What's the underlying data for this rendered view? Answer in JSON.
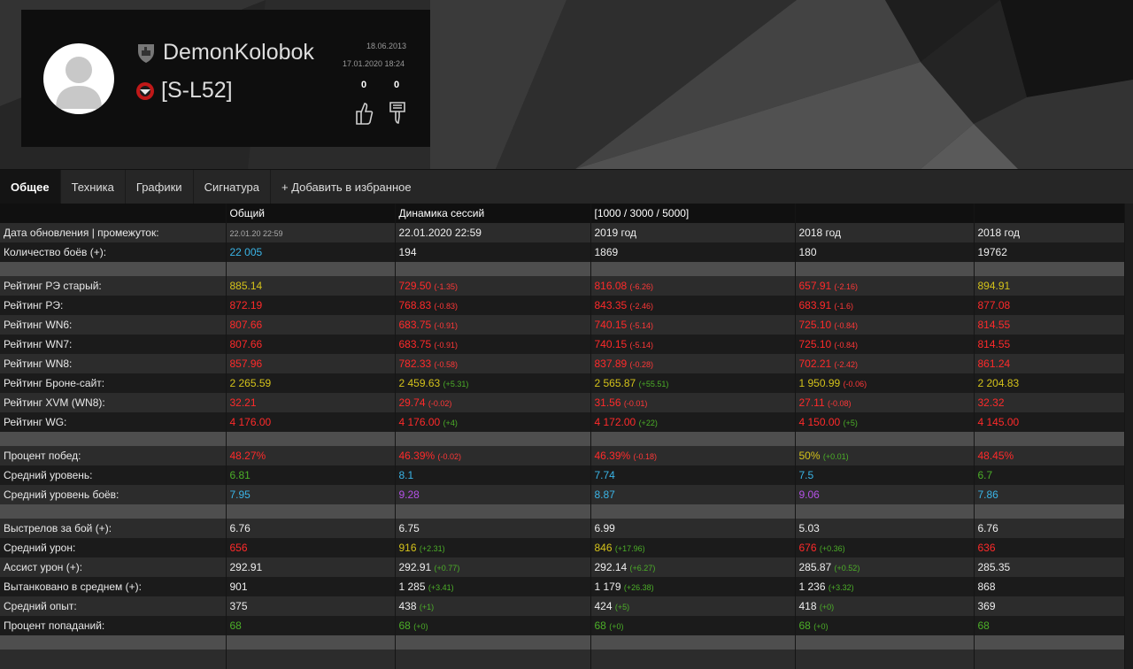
{
  "colors": {
    "red": "#ff2a2a",
    "yellow": "#d4c21a",
    "blue": "#3ab4e6",
    "green": "#4caf28",
    "purple": "#b451e6",
    "white": "#eeeeee"
  },
  "profile": {
    "name": "DemonKolobok",
    "clan": "[S-L52]",
    "registered": "18.06.2013",
    "last_battle": "17.01.2020 18:24",
    "likes": "0",
    "dislikes": "0",
    "icons": [
      "avatar-placeholder",
      "tank-icon",
      "clan-emblem-icon",
      "thumbs-up-icon",
      "thumbs-down-icon"
    ]
  },
  "tabs": [
    {
      "label": "Общее",
      "active": true
    },
    {
      "label": "Техника"
    },
    {
      "label": "Графики"
    },
    {
      "label": "Сигнатура"
    },
    {
      "label": "+ Добавить в избранное"
    }
  ],
  "table": {
    "headers": [
      "",
      "Общий",
      "Динамика сессий",
      "[1000 / 3000 / 5000]",
      "",
      ""
    ],
    "rows": [
      {
        "label": "Дата обновления | промежуток:",
        "cells": [
          {
            "v": "22.01.20 22:59",
            "c": "small"
          },
          {
            "v": "22.01.2020 22:59",
            "c": "white"
          },
          {
            "v": "2019 год",
            "c": "white"
          },
          {
            "v": "2018 год",
            "c": "white"
          },
          {
            "v": "2018 год",
            "c": "white"
          }
        ]
      },
      {
        "label": "Количество боёв (+):",
        "cells": [
          {
            "v": "22 005",
            "c": "blue"
          },
          {
            "v": "194",
            "c": "white"
          },
          {
            "v": "1869",
            "c": "white"
          },
          {
            "v": "180",
            "c": "white"
          },
          {
            "v": "19762",
            "c": "white"
          }
        ]
      },
      {
        "sep": true
      },
      {
        "label": "Рейтинг РЭ старый:",
        "cells": [
          {
            "v": "885.14",
            "c": "yellow"
          },
          {
            "v": "729.50",
            "c": "red",
            "d": "(-1.35)",
            "dc": "red"
          },
          {
            "v": "816.08",
            "c": "red",
            "d": "(-6.26)",
            "dc": "red"
          },
          {
            "v": "657.91",
            "c": "red",
            "d": "(-2.16)",
            "dc": "red"
          },
          {
            "v": "894.91",
            "c": "yellow"
          }
        ]
      },
      {
        "label": "Рейтинг РЭ:",
        "cells": [
          {
            "v": "872.19",
            "c": "red"
          },
          {
            "v": "768.83",
            "c": "red",
            "d": "(-0.83)",
            "dc": "red"
          },
          {
            "v": "843.35",
            "c": "red",
            "d": "(-2.46)",
            "dc": "red"
          },
          {
            "v": "683.91",
            "c": "red",
            "d": "(-1.6)",
            "dc": "red"
          },
          {
            "v": "877.08",
            "c": "red"
          }
        ]
      },
      {
        "label": "Рейтинг WN6:",
        "cells": [
          {
            "v": "807.66",
            "c": "red"
          },
          {
            "v": "683.75",
            "c": "red",
            "d": "(-0.91)",
            "dc": "red"
          },
          {
            "v": "740.15",
            "c": "red",
            "d": "(-5.14)",
            "dc": "red"
          },
          {
            "v": "725.10",
            "c": "red",
            "d": "(-0.84)",
            "dc": "red"
          },
          {
            "v": "814.55",
            "c": "red"
          }
        ]
      },
      {
        "label": "Рейтинг WN7:",
        "cells": [
          {
            "v": "807.66",
            "c": "red"
          },
          {
            "v": "683.75",
            "c": "red",
            "d": "(-0.91)",
            "dc": "red"
          },
          {
            "v": "740.15",
            "c": "red",
            "d": "(-5.14)",
            "dc": "red"
          },
          {
            "v": "725.10",
            "c": "red",
            "d": "(-0.84)",
            "dc": "red"
          },
          {
            "v": "814.55",
            "c": "red"
          }
        ]
      },
      {
        "label": "Рейтинг WN8:",
        "cells": [
          {
            "v": "857.96",
            "c": "red"
          },
          {
            "v": "782.33",
            "c": "red",
            "d": "(-0.58)",
            "dc": "red"
          },
          {
            "v": "837.89",
            "c": "red",
            "d": "(-0.28)",
            "dc": "red"
          },
          {
            "v": "702.21",
            "c": "red",
            "d": "(-2.42)",
            "dc": "red"
          },
          {
            "v": "861.24",
            "c": "red"
          }
        ]
      },
      {
        "label": "Рейтинг Броне-сайт:",
        "cells": [
          {
            "v": "2 265.59",
            "c": "yellow"
          },
          {
            "v": "2 459.63",
            "c": "yellow",
            "d": "(+5.31)",
            "dc": "grn"
          },
          {
            "v": "2 565.87",
            "c": "yellow",
            "d": "(+55.51)",
            "dc": "grn"
          },
          {
            "v": "1 950.99",
            "c": "yellow",
            "d": "(-0.06)",
            "dc": "red"
          },
          {
            "v": "2 204.83",
            "c": "yellow"
          }
        ]
      },
      {
        "label": "Рейтинг XVM (WN8):",
        "cells": [
          {
            "v": "32.21",
            "c": "red"
          },
          {
            "v": "29.74",
            "c": "red",
            "d": "(-0.02)",
            "dc": "red"
          },
          {
            "v": "31.56",
            "c": "red",
            "d": "(-0.01)",
            "dc": "red"
          },
          {
            "v": "27.11",
            "c": "red",
            "d": "(-0.08)",
            "dc": "red"
          },
          {
            "v": "32.32",
            "c": "red"
          }
        ]
      },
      {
        "label": "Рейтинг WG:",
        "cells": [
          {
            "v": "4 176.00",
            "c": "red"
          },
          {
            "v": "4 176.00",
            "c": "red",
            "d": "(+4)",
            "dc": "grn"
          },
          {
            "v": "4 172.00",
            "c": "red",
            "d": "(+22)",
            "dc": "grn"
          },
          {
            "v": "4 150.00",
            "c": "red",
            "d": "(+5)",
            "dc": "grn"
          },
          {
            "v": "4 145.00",
            "c": "red"
          }
        ]
      },
      {
        "sep": true
      },
      {
        "label": "Процент побед:",
        "cells": [
          {
            "v": "48.27%",
            "c": "red"
          },
          {
            "v": "46.39%",
            "c": "red",
            "d": "(-0.02)",
            "dc": "red"
          },
          {
            "v": "46.39%",
            "c": "red",
            "d": "(-0.18)",
            "dc": "red"
          },
          {
            "v": "50%",
            "c": "yellow",
            "d": "(+0.01)",
            "dc": "grn"
          },
          {
            "v": "48.45%",
            "c": "red"
          }
        ]
      },
      {
        "label": "Средний уровень:",
        "cells": [
          {
            "v": "6.81",
            "c": "green"
          },
          {
            "v": "8.1",
            "c": "blue"
          },
          {
            "v": "7.74",
            "c": "blue"
          },
          {
            "v": "7.5",
            "c": "blue"
          },
          {
            "v": "6.7",
            "c": "green"
          }
        ]
      },
      {
        "label": "Средний уровень боёв:",
        "cells": [
          {
            "v": "7.95",
            "c": "blue"
          },
          {
            "v": "9.28",
            "c": "purple"
          },
          {
            "v": "8.87",
            "c": "blue"
          },
          {
            "v": "9.06",
            "c": "purple"
          },
          {
            "v": "7.86",
            "c": "blue"
          }
        ]
      },
      {
        "sep": true
      },
      {
        "label": "Выстрелов за бой (+):",
        "cells": [
          {
            "v": "6.76",
            "c": "white"
          },
          {
            "v": "6.75",
            "c": "white"
          },
          {
            "v": "6.99",
            "c": "white"
          },
          {
            "v": "5.03",
            "c": "white"
          },
          {
            "v": "6.76",
            "c": "white"
          }
        ]
      },
      {
        "label": "Средний урон:",
        "cells": [
          {
            "v": "656",
            "c": "red"
          },
          {
            "v": "916",
            "c": "yellow",
            "d": "(+2.31)",
            "dc": "grn"
          },
          {
            "v": "846",
            "c": "yellow",
            "d": "(+17.96)",
            "dc": "grn"
          },
          {
            "v": "676",
            "c": "red",
            "d": "(+0.36)",
            "dc": "grn"
          },
          {
            "v": "636",
            "c": "red"
          }
        ]
      },
      {
        "label": "Ассист урон (+):",
        "cells": [
          {
            "v": "292.91",
            "c": "white"
          },
          {
            "v": "292.91",
            "c": "white",
            "d": "(+0.77)",
            "dc": "grn"
          },
          {
            "v": "292.14",
            "c": "white",
            "d": "(+6.27)",
            "dc": "grn"
          },
          {
            "v": "285.87",
            "c": "white",
            "d": "(+0.52)",
            "dc": "grn"
          },
          {
            "v": "285.35",
            "c": "white"
          }
        ]
      },
      {
        "label": "Вытанковано в среднем (+):",
        "cells": [
          {
            "v": "901",
            "c": "white"
          },
          {
            "v": "1 285",
            "c": "white",
            "d": "(+3.41)",
            "dc": "grn"
          },
          {
            "v": "1 179",
            "c": "white",
            "d": "(+26.38)",
            "dc": "grn"
          },
          {
            "v": "1 236",
            "c": "white",
            "d": "(+3.32)",
            "dc": "grn"
          },
          {
            "v": "868",
            "c": "white"
          }
        ]
      },
      {
        "label": "Средний опыт:",
        "cells": [
          {
            "v": "375",
            "c": "white"
          },
          {
            "v": "438",
            "c": "white",
            "d": "(+1)",
            "dc": "grn"
          },
          {
            "v": "424",
            "c": "white",
            "d": "(+5)",
            "dc": "grn"
          },
          {
            "v": "418",
            "c": "white",
            "d": "(+0)",
            "dc": "grn"
          },
          {
            "v": "369",
            "c": "white"
          }
        ]
      },
      {
        "label": "Процент попаданий:",
        "cells": [
          {
            "v": "68",
            "c": "green"
          },
          {
            "v": "68",
            "c": "green",
            "d": "(+0)",
            "dc": "grn"
          },
          {
            "v": "68",
            "c": "green",
            "d": "(+0)",
            "dc": "grn"
          },
          {
            "v": "68",
            "c": "green",
            "d": "(+0)",
            "dc": "grn"
          },
          {
            "v": "68",
            "c": "green"
          }
        ]
      },
      {
        "sep": true
      },
      {
        "label": "",
        "cells": [
          {
            "v": "",
            "c": "white"
          },
          {
            "v": "",
            "c": "white"
          },
          {
            "v": "",
            "c": "white"
          },
          {
            "v": "",
            "c": "white"
          },
          {
            "v": "",
            "c": "white"
          }
        ]
      }
    ]
  }
}
